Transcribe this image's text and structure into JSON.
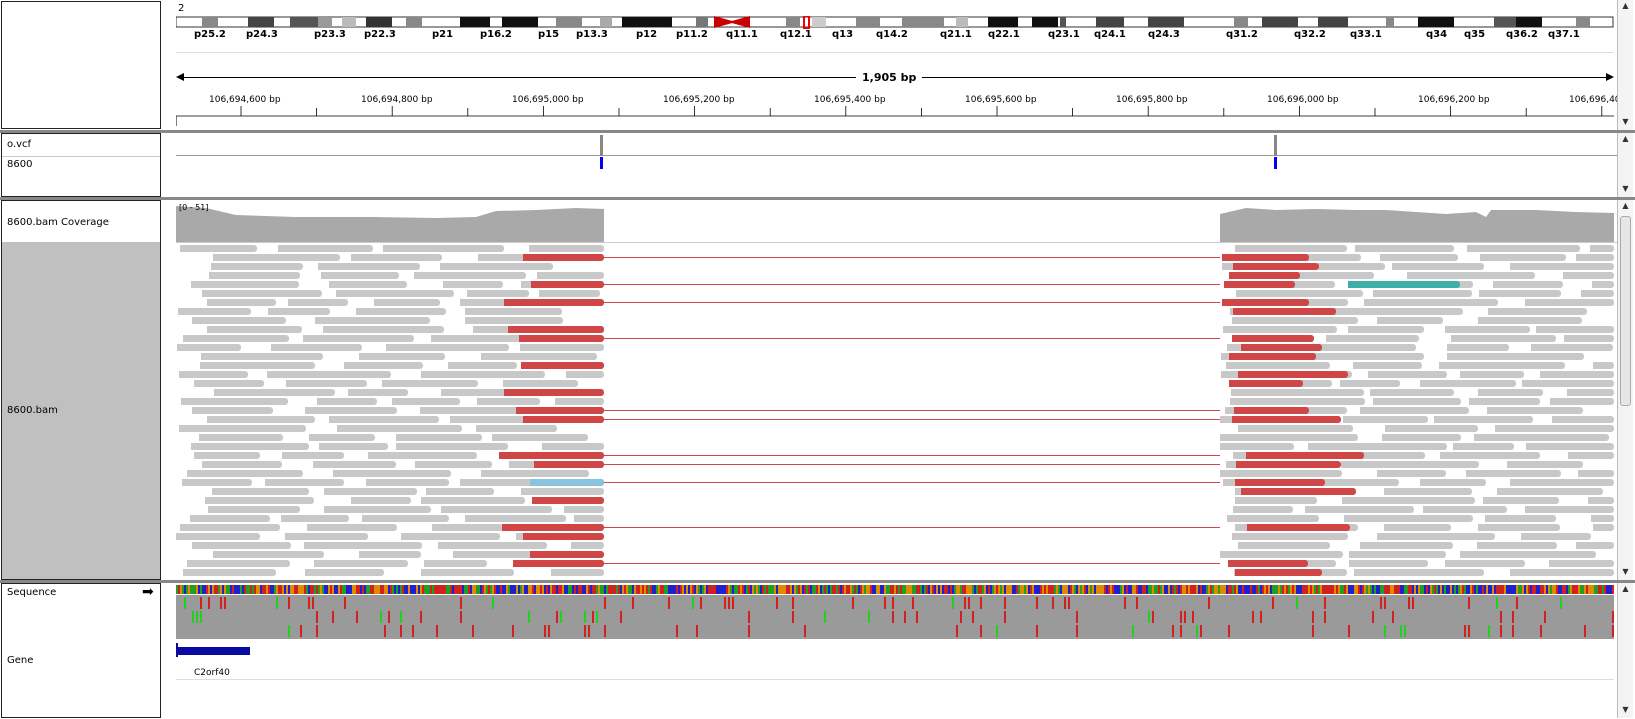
{
  "header": {
    "chromosome": "2",
    "bands": [
      "p25.2",
      "p24.3",
      "p23.3",
      "p22.3",
      "p21",
      "p16.2",
      "p15",
      "p13.3",
      "p12",
      "p11.2",
      "q11.1",
      "q12.1",
      "q13",
      "q14.2",
      "q21.1",
      "q22.1",
      "q23.1",
      "q24.1",
      "q24.3",
      "q31.2",
      "q32.2",
      "q33.1",
      "q34",
      "q35",
      "q36.2",
      "q37.1"
    ],
    "span_label": "1,905 bp",
    "ticks": [
      "106,694,600 bp",
      "106,694,800 bp",
      "106,695,000 bp",
      "106,695,200 bp",
      "106,695,400 bp",
      "106,695,600 bp",
      "106,695,800 bp",
      "106,696,000 bp",
      "106,696,200 bp",
      "106,696,40"
    ]
  },
  "tracks": {
    "vcf_name": "o.vcf",
    "sample_name": "8600",
    "coverage_name": "8600.bam Coverage",
    "coverage_range": "[0 - 51]",
    "bam_name": "8600.bam",
    "sequence_name": "Sequence",
    "gene_name": "Gene",
    "gene_label": "C2orf40"
  },
  "colors": {
    "discordant_read": "#d04545",
    "normal_read": "#c8c8c8",
    "coverage": "#a9a9a9",
    "variant_blue": "#0000ff",
    "gene_blue": "#0a0aa0",
    "teal_read": "#3cb0a8",
    "lightblue_read": "#88c4e0"
  }
}
